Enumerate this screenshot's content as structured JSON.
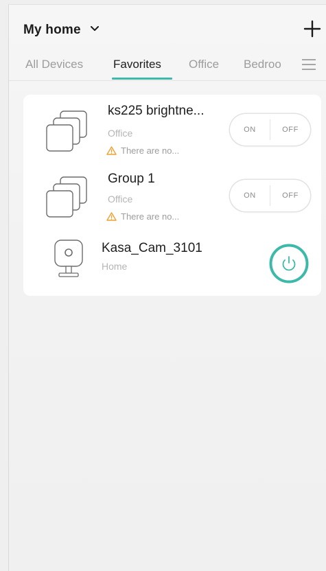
{
  "header": {
    "home_label": "My home"
  },
  "tabs": [
    {
      "label": "All Devices",
      "active": false
    },
    {
      "label": "Favorites",
      "active": true
    },
    {
      "label": "Office",
      "active": false
    },
    {
      "label": "Bedroo",
      "active": false
    }
  ],
  "devices": [
    {
      "name": "ks225 brightne...",
      "location": "Office",
      "warning": "There are no...",
      "on_label": "ON",
      "off_label": "OFF",
      "icon": "switch-stack-icon"
    },
    {
      "name": "Group 1",
      "location": "Office",
      "warning": "There are no...",
      "on_label": "ON",
      "off_label": "OFF",
      "icon": "switch-stack-icon"
    },
    {
      "name": "Kasa_Cam_3101",
      "location": "Home",
      "icon": "camera-icon"
    }
  ],
  "colors": {
    "accent": "#3cb9a9",
    "warning": "#f0a030",
    "background": "#f2f2f2",
    "card": "#ffffff"
  }
}
